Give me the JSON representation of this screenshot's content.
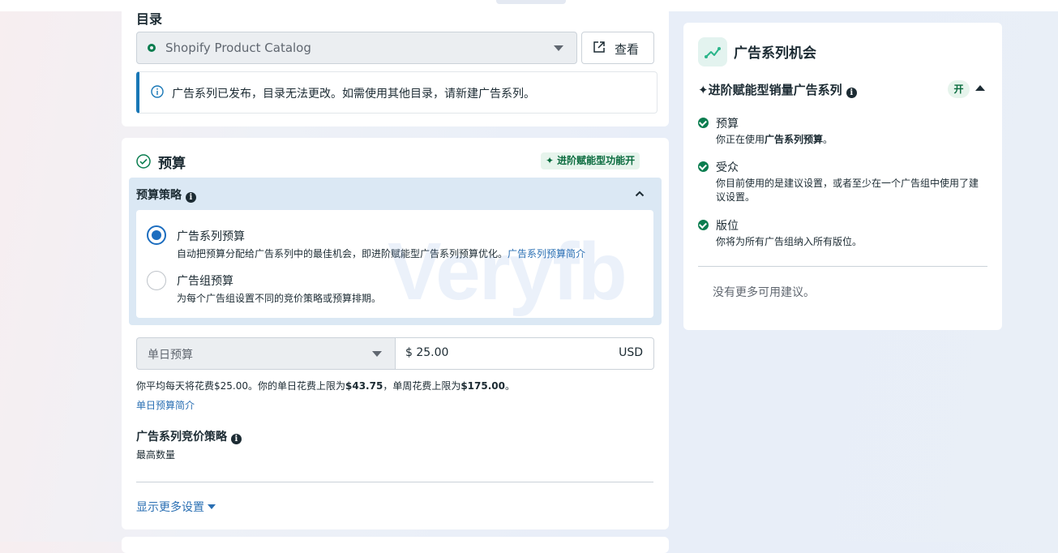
{
  "catalog": {
    "title": "目录",
    "selected": "Shopify Product Catalog",
    "view_label": "查看",
    "info": "广告系列已发布，目录无法更改。如需使用其他目录，请新建广告系列。"
  },
  "budget": {
    "title": "预算",
    "advantage_badge": "进阶赋能型功能开",
    "strategy_label": "预算策略",
    "options": [
      {
        "title": "广告系列预算",
        "desc": "自动把预算分配给广告系列中的最佳机会，即进阶赋能型广告系列预算优化。",
        "link": "广告系列预算简介",
        "selected": true
      },
      {
        "title": "广告组预算",
        "desc": "为每个广告组设置不同的竞价策略或预算排期。",
        "selected": false
      }
    ],
    "type_selected": "单日预算",
    "amount": "$ 25.00",
    "currency": "USD",
    "note": {
      "prefix": "你平均每天将花费$25.00。你的单日花费上限为",
      "daily_cap": "$43.75",
      "middle": "，单周花费上限为",
      "weekly_cap": "$175.00",
      "suffix": "。"
    },
    "intro_link": "单日预算简介",
    "bid_title": "广告系列竞价策略",
    "bid_value": "最高数量",
    "more_settings": "显示更多设置"
  },
  "opportunities": {
    "title": "广告系列机会",
    "subtitle": "进阶赋能型销量广告系列",
    "status": "开",
    "items": [
      {
        "title": "预算",
        "desc_prefix": "你正在使用",
        "desc_bold": "广告系列预算",
        "desc_suffix": "。"
      },
      {
        "title": "受众",
        "desc": "你目前使用的是建议设置，或者至少在一个广告组中使用了建议设置。"
      },
      {
        "title": "版位",
        "desc": "你将为所有广告组纳入所有版位。"
      }
    ],
    "empty": "没有更多可用建议。"
  },
  "watermark": "Veryfb",
  "colors": {
    "link": "#2a6fb3",
    "radio": "#1c6dbf",
    "success": "#0a7d4f",
    "panel": "#dbe8f4"
  },
  "icons": [
    "info-icon",
    "external-link-icon",
    "check-circle-icon",
    "sparkle-icon",
    "chevron-up-icon",
    "caret-down-icon",
    "opportunity-icon"
  ]
}
